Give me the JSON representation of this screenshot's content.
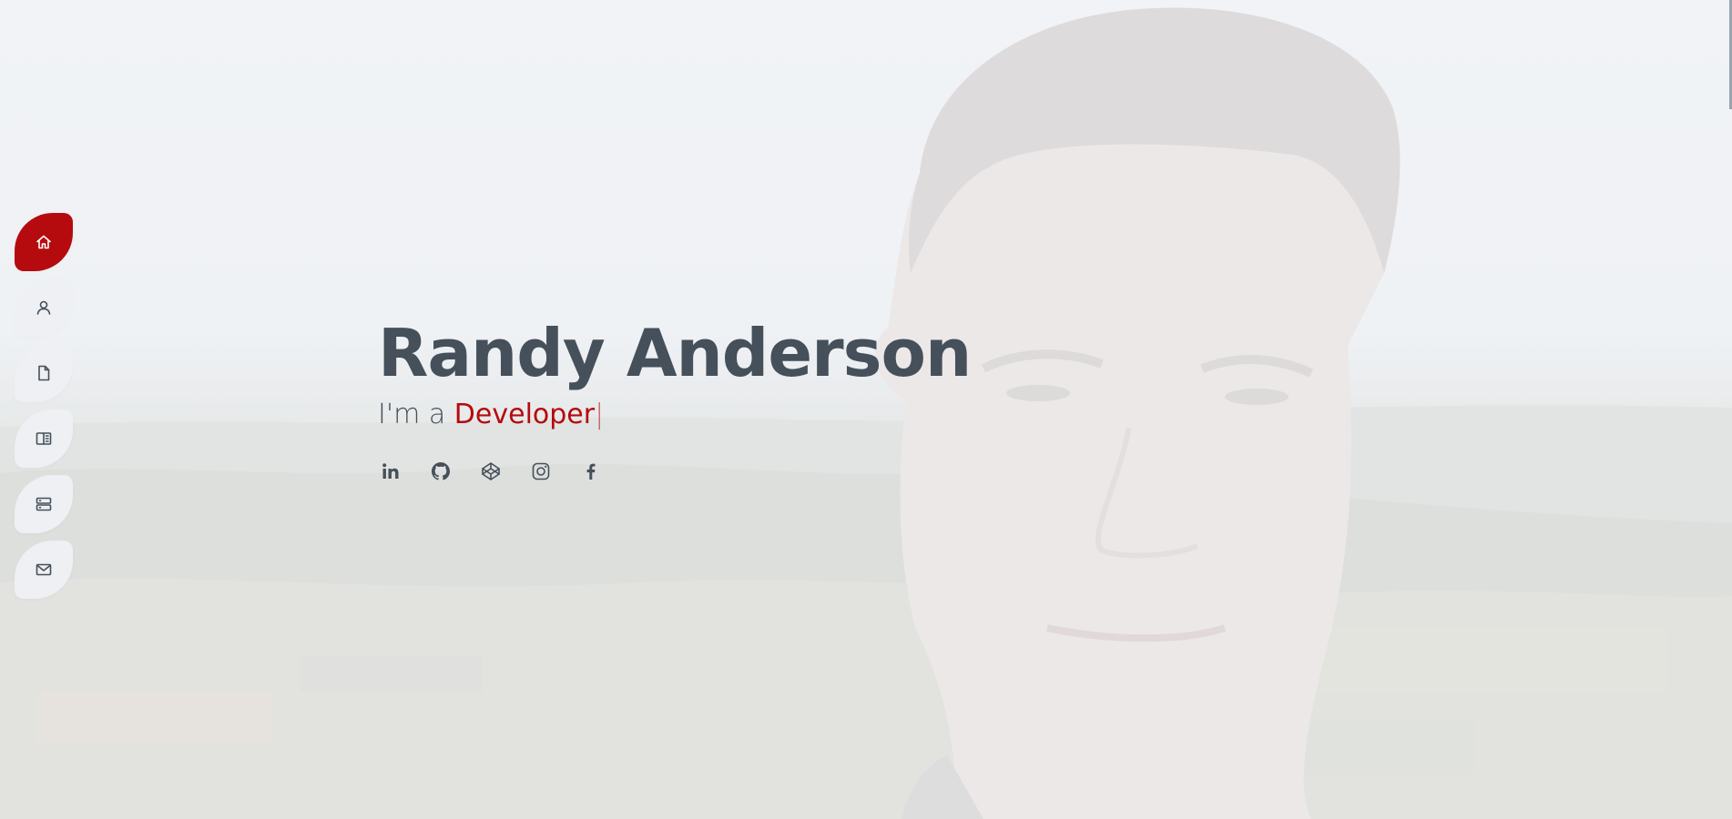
{
  "hero": {
    "name": "Randy Anderson",
    "tagline_prefix": "I'm a",
    "typed_role": "Developer",
    "typed_cursor": "|"
  },
  "nav": {
    "items": [
      {
        "id": "home",
        "icon": "home-icon",
        "active": true
      },
      {
        "id": "about",
        "icon": "person-icon",
        "active": false
      },
      {
        "id": "resume",
        "icon": "file-icon",
        "active": false
      },
      {
        "id": "portfolio",
        "icon": "book-half-icon",
        "active": false
      },
      {
        "id": "services",
        "icon": "server-icon",
        "active": false
      },
      {
        "id": "contact",
        "icon": "envelope-icon",
        "active": false
      }
    ]
  },
  "socials": [
    {
      "id": "linkedin",
      "icon": "linkedin-icon"
    },
    {
      "id": "github",
      "icon": "github-icon"
    },
    {
      "id": "codepen",
      "icon": "codepen-icon"
    },
    {
      "id": "instagram",
      "icon": "instagram-icon"
    },
    {
      "id": "facebook",
      "icon": "facebook-icon"
    }
  ],
  "colors": {
    "accent": "#b50b0f",
    "text": "#45505b",
    "nav_bg": "#eef0f3"
  }
}
